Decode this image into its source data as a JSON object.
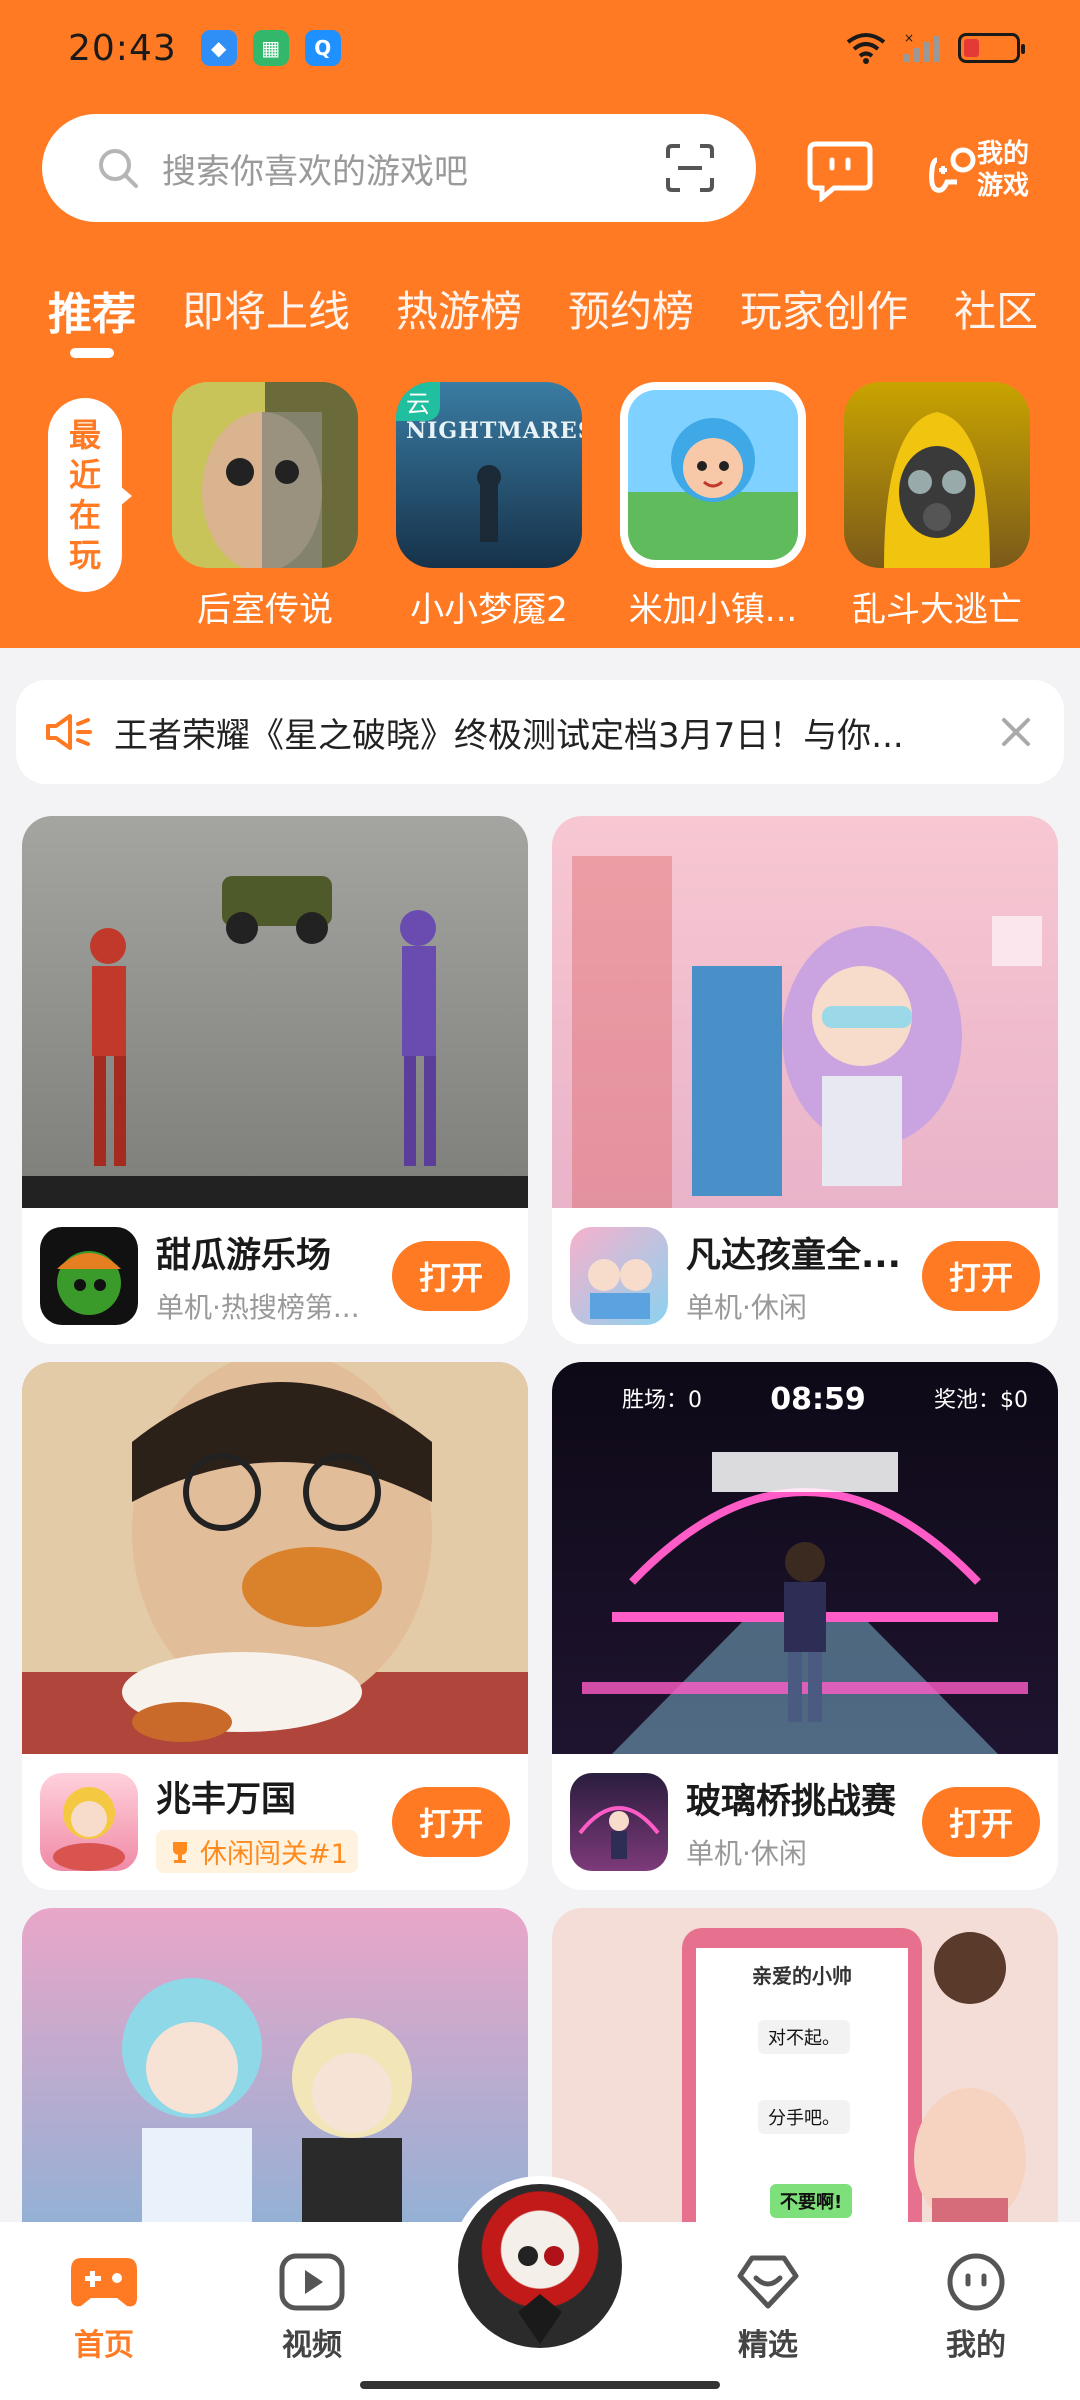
{
  "status_bar": {
    "time": "20:43",
    "apps": [
      {
        "name": "app-blue-icon",
        "color": "#2f8ff7",
        "glyph": "◆"
      },
      {
        "name": "app-green-icon",
        "color": "#33b86b",
        "glyph": "▦"
      },
      {
        "name": "app-qq-icon",
        "color": "#1e90ff",
        "glyph": "Q"
      }
    ],
    "battery_color": "#e53935"
  },
  "search": {
    "placeholder": "搜索你喜欢的游戏吧"
  },
  "header_actions": {
    "my_games_label": "我的游戏"
  },
  "tabs": [
    {
      "label": "推荐",
      "active": true
    },
    {
      "label": "即将上线"
    },
    {
      "label": "热游榜"
    },
    {
      "label": "预约榜"
    },
    {
      "label": "玩家创作"
    },
    {
      "label": "社区"
    }
  ],
  "recent": {
    "label_chars": [
      "最",
      "近",
      "在",
      "玩"
    ],
    "games": [
      {
        "name": "后室传说",
        "colors": [
          "#c8c45a",
          "#6b6a3a"
        ]
      },
      {
        "name": "小小梦魇2",
        "colors": [
          "#3a7ca3",
          "#16324a"
        ],
        "cloud_badge": "云",
        "logo_text": "NIGHTMARES"
      },
      {
        "name": "米加小镇...",
        "colors": [
          "#7fd2ff",
          "#5fbb5b"
        ]
      },
      {
        "name": "乱斗大逃亡",
        "colors": [
          "#f1c40f",
          "#7a5a1a"
        ]
      }
    ]
  },
  "notice": {
    "text": "王者荣耀《星之破晓》终极测试定档3月7日！与你..."
  },
  "cards": [
    {
      "title": "甜瓜游乐场",
      "subtitle": "单机·热搜榜第...",
      "button": "打开",
      "img_colors": [
        "#9fa09c",
        "#6f706c"
      ],
      "icon_color": "#2f8a1f"
    },
    {
      "title": "凡达孩童全...",
      "subtitle": "单机·休闲",
      "button": "打开",
      "img_colors": [
        "#f7c7d2",
        "#c9a4e0"
      ],
      "icon_color": "#f0a0c0"
    },
    {
      "title": "兆丰万国",
      "badge": "休闲闯关#1",
      "button": "打开",
      "img_colors": [
        "#e0b48a",
        "#a34a3a"
      ],
      "icon_color": "#ffb6c8"
    },
    {
      "title": "玻璃桥挑战赛",
      "subtitle": "单机·休闲",
      "button": "打开",
      "img_colors": [
        "#1a1024",
        "#d04fa0"
      ],
      "icon_color": "#3b2b55",
      "hud": {
        "wins": "胜场：0",
        "timer": "08:59",
        "pool": "奖池：$0"
      }
    },
    {
      "title": "",
      "img_colors": [
        "#e9a6c8",
        "#7fb3d8"
      ]
    },
    {
      "title": "",
      "img_colors": [
        "#f5d8d0",
        "#e59cab"
      ],
      "chat": {
        "title": "亲爱的小帅",
        "m1": "对不起。",
        "m2": "分手吧。",
        "m3": "不要啊!"
      }
    }
  ],
  "nav": [
    {
      "label": "首页",
      "active": true
    },
    {
      "label": "视频"
    },
    {
      "label": "精选"
    },
    {
      "label": "我的"
    }
  ],
  "accent_color": "#ff7a22"
}
